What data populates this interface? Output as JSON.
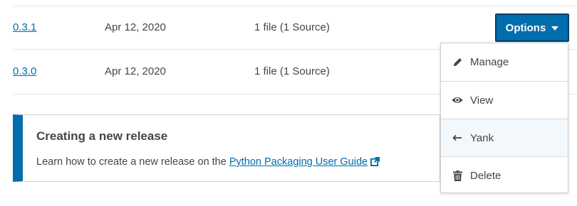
{
  "releases": [
    {
      "version": "0.3.1",
      "date": "Apr 12, 2020",
      "files": "1 file (1 Source)"
    },
    {
      "version": "0.3.0",
      "date": "Apr 12, 2020",
      "files": "1 file (1 Source)"
    }
  ],
  "options_button": {
    "label": "Options",
    "icon": "caret-down-icon"
  },
  "menu": {
    "items": [
      {
        "label": "Manage",
        "icon": "pencil-icon"
      },
      {
        "label": "View",
        "icon": "eye-icon"
      },
      {
        "label": "Yank",
        "icon": "arrow-left-icon"
      },
      {
        "label": "Delete",
        "icon": "trash-icon"
      }
    ]
  },
  "callout": {
    "heading": "Creating a new release",
    "body_prefix": "Learn how to create a new release on the ",
    "link_text": "Python Packaging User Guide",
    "link_icon": "external-link-icon"
  },
  "colors": {
    "accent": "#006dad",
    "text": "#464646",
    "border": "#d3d3d3"
  }
}
